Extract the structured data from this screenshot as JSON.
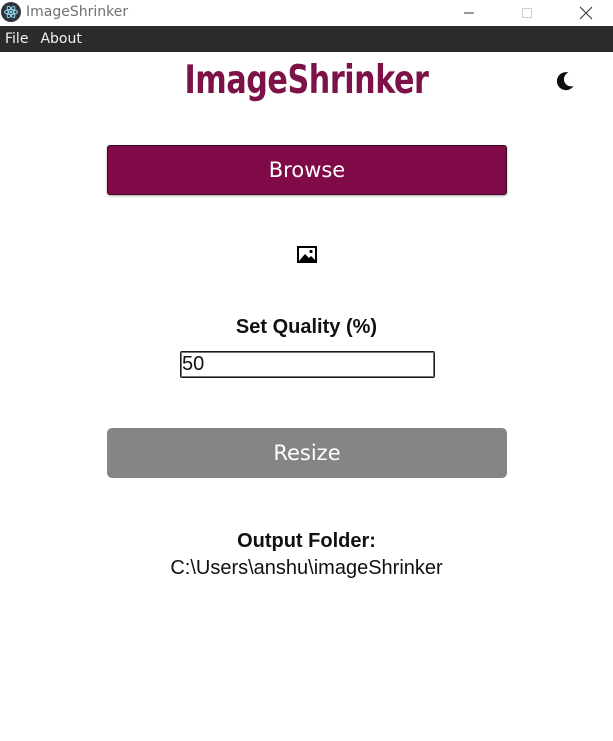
{
  "window": {
    "title": "ImageShrinker",
    "icon": "electron-app-icon",
    "controls": [
      "minimize-icon",
      "maximize-icon",
      "close-icon"
    ]
  },
  "menu": {
    "items": [
      {
        "label": "File"
      },
      {
        "label": "About"
      }
    ]
  },
  "header": {
    "title": "ImageShrinker",
    "theme_toggle_icon": "moon-icon"
  },
  "browse": {
    "label": "Browse"
  },
  "preview": {
    "icon": "image-icon"
  },
  "quality": {
    "label": "Set Quality (%)",
    "value": "50"
  },
  "resize": {
    "label": "Resize"
  },
  "output": {
    "label": "Output Folder:",
    "path": "C:\\Users\\anshu\\imageShrinker"
  },
  "colors": {
    "accent": "#800a47",
    "title": "#7d1249",
    "menubar": "#2b2b2d",
    "disabled_button": "#858585"
  }
}
